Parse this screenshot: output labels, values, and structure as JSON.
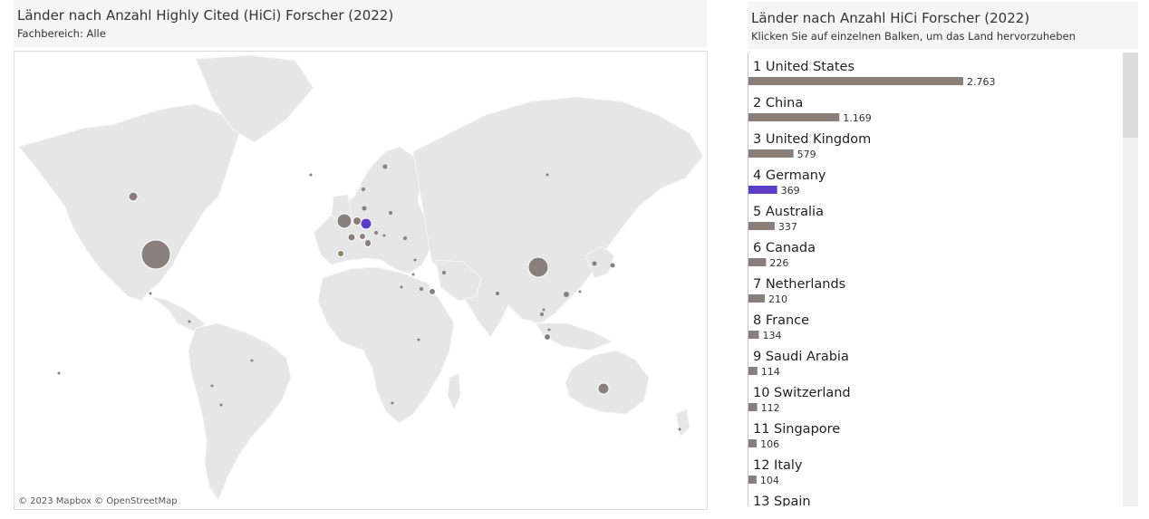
{
  "map_header": {
    "title": "Länder nach Anzahl Highly Cited (HiCi) Forscher (2022)",
    "subtitle": "Fachbereich: Alle"
  },
  "bar_header": {
    "title": "Länder nach Anzahl HiCi Forscher (2022)",
    "subtitle": "Klicken Sie auf einzelnen Balken, um das Land hervorzuheben"
  },
  "map": {
    "credit": "© 2023 Mapbox  © OpenStreetMap",
    "highlight_country": "Germany"
  },
  "colors": {
    "bar": "#8a7f7b",
    "highlight": "#5b3cc4",
    "land": "#e6e6e6",
    "land_alt": "#eeeeee",
    "water": "#ffffff"
  },
  "chart_data": {
    "type": "bar",
    "orientation": "horizontal",
    "highlighted": "Germany",
    "categories": [
      "United States",
      "China",
      "United Kingdom",
      "Germany",
      "Australia",
      "Canada",
      "Netherlands",
      "France",
      "Saudi Arabia",
      "Switzerland",
      "Singapore",
      "Italy",
      "Spain"
    ],
    "ranks": [
      1,
      2,
      3,
      4,
      5,
      6,
      7,
      8,
      9,
      10,
      11,
      12,
      13
    ],
    "values": [
      2763,
      1169,
      579,
      369,
      337,
      226,
      210,
      134,
      114,
      112,
      106,
      104,
      null
    ],
    "value_labels": [
      "2.763",
      "1.169",
      "579",
      "369",
      "337",
      "226",
      "210",
      "134",
      "114",
      "112",
      "106",
      "104",
      ""
    ]
  }
}
